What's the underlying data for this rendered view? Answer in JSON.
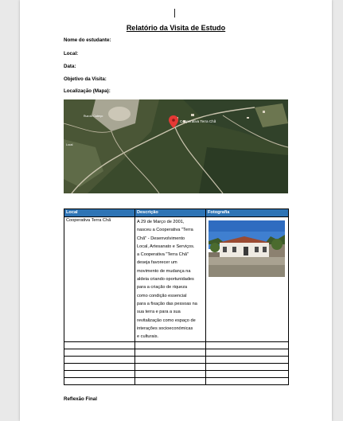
{
  "document": {
    "title": "Relatório da Visita de Estudo",
    "fields": [
      "Nome do estudante:",
      "Local:",
      "Data:",
      "Objetivo da Visita:",
      "Localização (Mapa):"
    ],
    "map": {
      "pin_label": "Cooperativa Terra Chã",
      "road_label_1": "Rua do Cabeço",
      "road_label_2": "Local"
    },
    "table": {
      "headers": [
        "Local",
        "Descrição",
        "Fotografia"
      ],
      "row": {
        "local": "Cooperativa Terra Chã",
        "description_lines": [
          "A 29 de Março de 2001,",
          "nasceu a Cooperativa  \"Terra",
          "Chã\"  - Desenvolvimento",
          "Local, Artesanato e Serviços.",
          "a Cooperativa  \"Terra Chã\"",
          "deseja favorecer um",
          "movimento de mudança na",
          "aldeia criando oportunidades",
          "para a criação de riqueza",
          "como condição essencial",
          "para a fixação das pessoas na",
          "sua terra e para a sua",
          "revitalização como espaço de",
          "interações socioeconómicas",
          "e culturais."
        ]
      },
      "empty_rows": 6
    },
    "final_section": "Reflexão Final"
  },
  "colors": {
    "header_bg": "#2e74b5",
    "pin": "#e53935"
  }
}
